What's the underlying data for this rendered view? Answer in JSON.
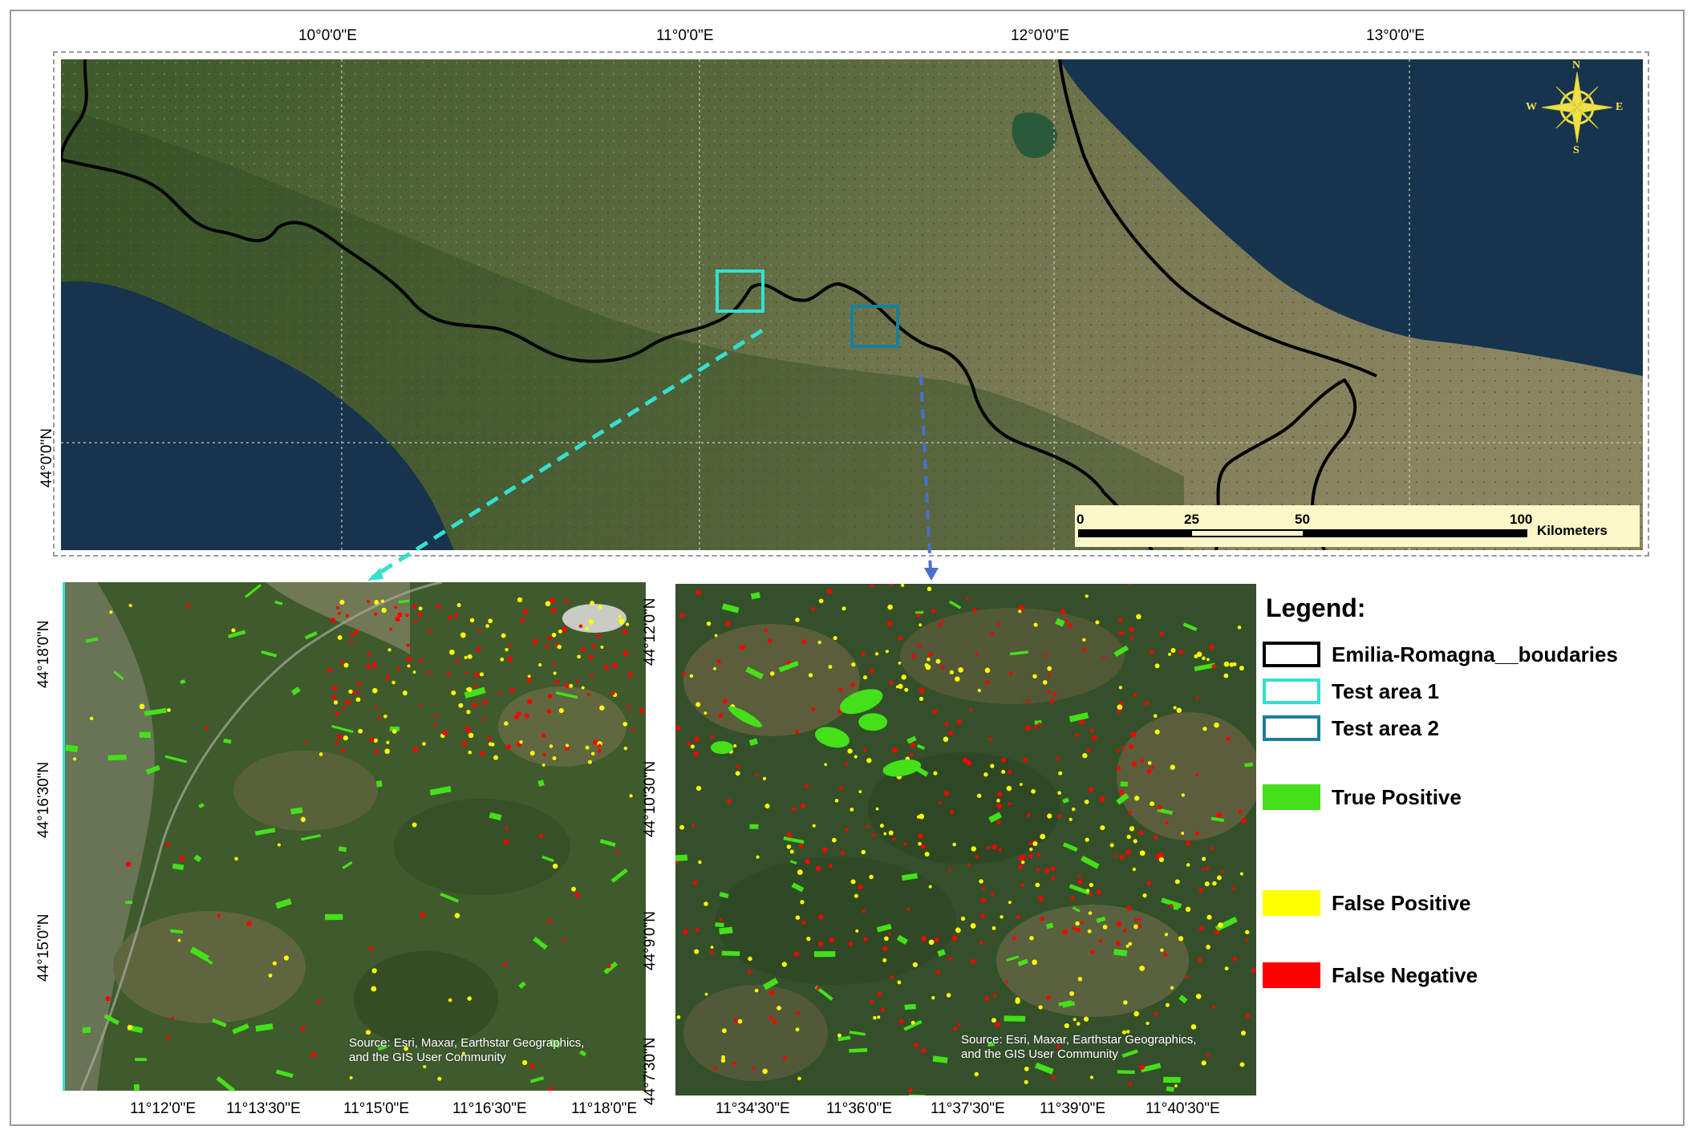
{
  "overview": {
    "top_labels": [
      "10°0'0\"E",
      "11°0'0\"E",
      "12°0'0\"E",
      "13°0'0\"E"
    ],
    "left_labels": [
      "44°0'0\"N"
    ],
    "compass": {
      "n": "N",
      "s": "S",
      "e": "E",
      "w": "W"
    },
    "scale_bar": {
      "ticks": [
        "0",
        "25",
        "50",
        "100"
      ],
      "unit": "Kilometers"
    }
  },
  "area1": {
    "bottom_labels": [
      "11°12'0\"E",
      "11°13'30\"E",
      "11°15'0\"E",
      "11°16'30\"E",
      "11°18'0\"E"
    ],
    "left_labels": [
      "44°18'0\"N",
      "44°16'30\"N",
      "44°15'0\"N"
    ],
    "credit": "Source: Esri, Maxar, Earthstar Geographics, and the GIS User Community"
  },
  "area2": {
    "bottom_labels": [
      "11°34'30\"E",
      "11°36'0\"E",
      "11°37'30\"E",
      "11°39'0\"E",
      "11°40'30\"E"
    ],
    "left_labels": [
      "44°12'0\"N",
      "44°10'30\"N",
      "44°9'0\"N",
      "44°7'30\"N"
    ],
    "credit": "Source: Esri, Maxar, Earthstar Geographics, and the GIS User Community"
  },
  "legend": {
    "title": "Legend:",
    "items": [
      {
        "label": "Emilia-Romagna__boudaries",
        "symbol": "outline",
        "color": "#000000"
      },
      {
        "label": "Test area 1",
        "symbol": "outline",
        "color": "#33e0d0"
      },
      {
        "label": "Test area 2",
        "symbol": "outline",
        "color": "#1a7f9e"
      },
      {
        "label": "True Positive",
        "symbol": "fill",
        "color": "#44e01a"
      },
      {
        "label": "False Positive",
        "symbol": "fill",
        "color": "#ffff00"
      },
      {
        "label": "False Negative",
        "symbol": "fill",
        "color": "#ff0000"
      }
    ]
  }
}
